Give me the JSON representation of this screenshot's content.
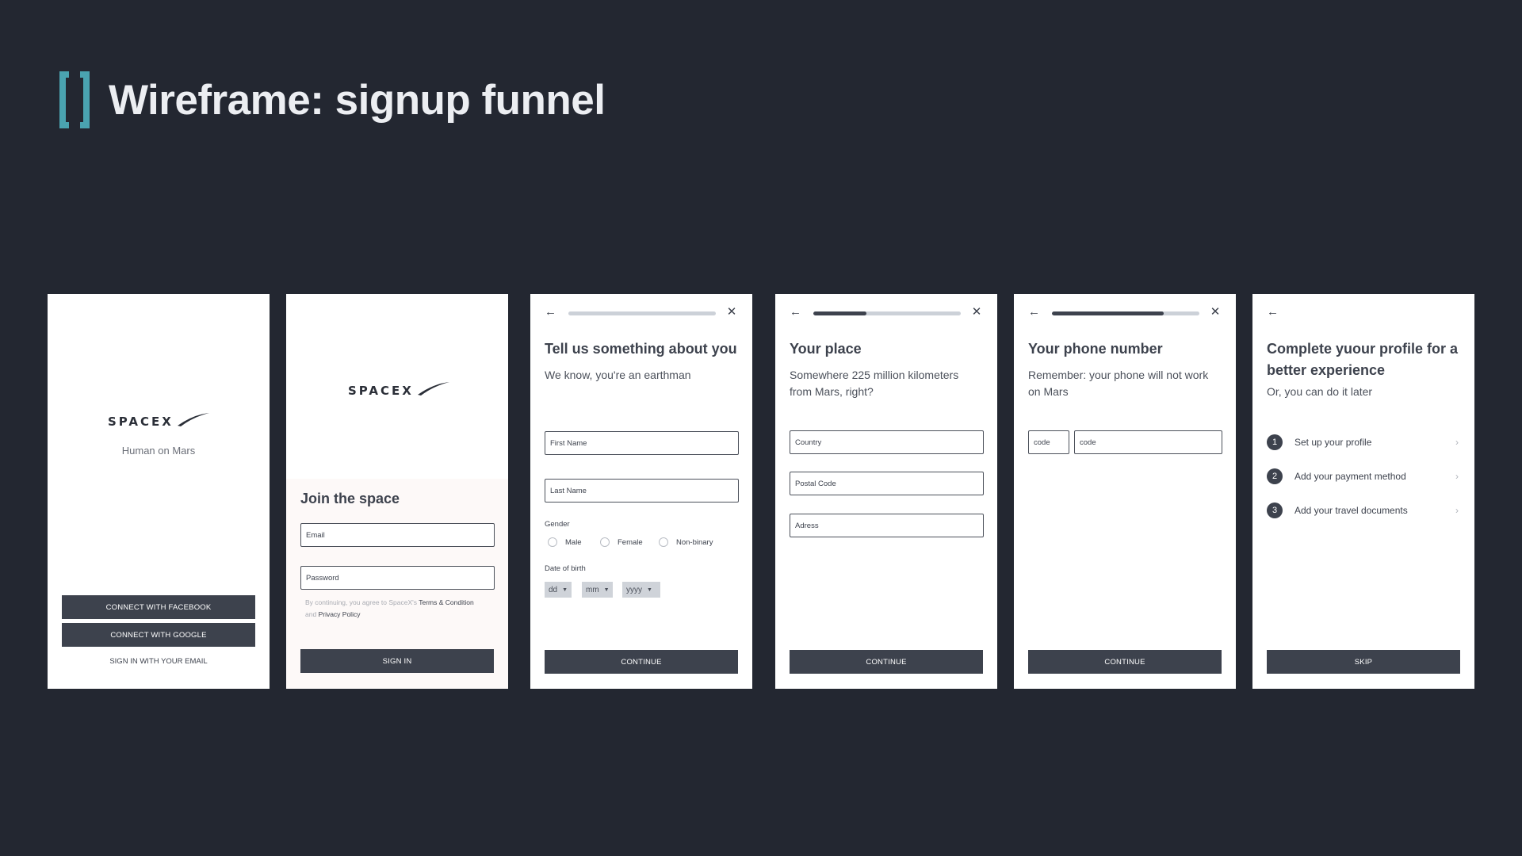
{
  "header": {
    "title": "Wireframe: signup funnel",
    "accent_color": "#4aa3b0"
  },
  "screens": {
    "welcome": {
      "logo_text": "SPACEX",
      "tagline": "Human on Mars",
      "facebook_button": "CONNECT WITH FACEBOOK",
      "google_button": "CONNECT WITH GOOGLE",
      "email_link": "SIGN IN WITH YOUR EMAIL"
    },
    "join": {
      "logo_text": "SPACEX",
      "heading": "Join the space",
      "email_placeholder": "Email",
      "password_placeholder": "Password",
      "legal_prefix": "By continuing, you agree to SpaceX's",
      "terms_link": "Terms & Condition",
      "legal_and": "and",
      "privacy_link": "Privacy Policy",
      "signin_button": "SIGN IN"
    },
    "about": {
      "progress": 0,
      "heading": "Tell  us something about you",
      "subtitle": "We know, you're an earthman",
      "first_name_placeholder": "First Name",
      "last_name_placeholder": "Last Name",
      "gender_label": "Gender",
      "gender_options": [
        "Male",
        "Female",
        "Non-binary"
      ],
      "dob_label": "Date of birth",
      "dob_selects": [
        "dd",
        "mm",
        "yyyy"
      ],
      "continue_button": "CONTINUE"
    },
    "place": {
      "progress": 0.36,
      "heading": "Your place",
      "subtitle": "Somewhere 225 million kilometers from Mars, right?",
      "country_placeholder": "Country",
      "postal_placeholder": "Postal Code",
      "address_placeholder": "Adress",
      "continue_button": "CONTINUE"
    },
    "phone": {
      "progress": 0.76,
      "heading": "Your phone number",
      "subtitle": "Remember: your phone will not work on Mars",
      "code_placeholder": "code",
      "number_placeholder": "code",
      "continue_button": "CONTINUE"
    },
    "profile": {
      "heading": "Complete yuour profile for a better experience",
      "subtitle": "Or, you can do it later",
      "steps": [
        {
          "num": "1",
          "label": "Set up your profile"
        },
        {
          "num": "2",
          "label": "Add your payment method"
        },
        {
          "num": "3",
          "label": "Add your travel documents"
        }
      ],
      "skip_button": "SKIP"
    }
  }
}
